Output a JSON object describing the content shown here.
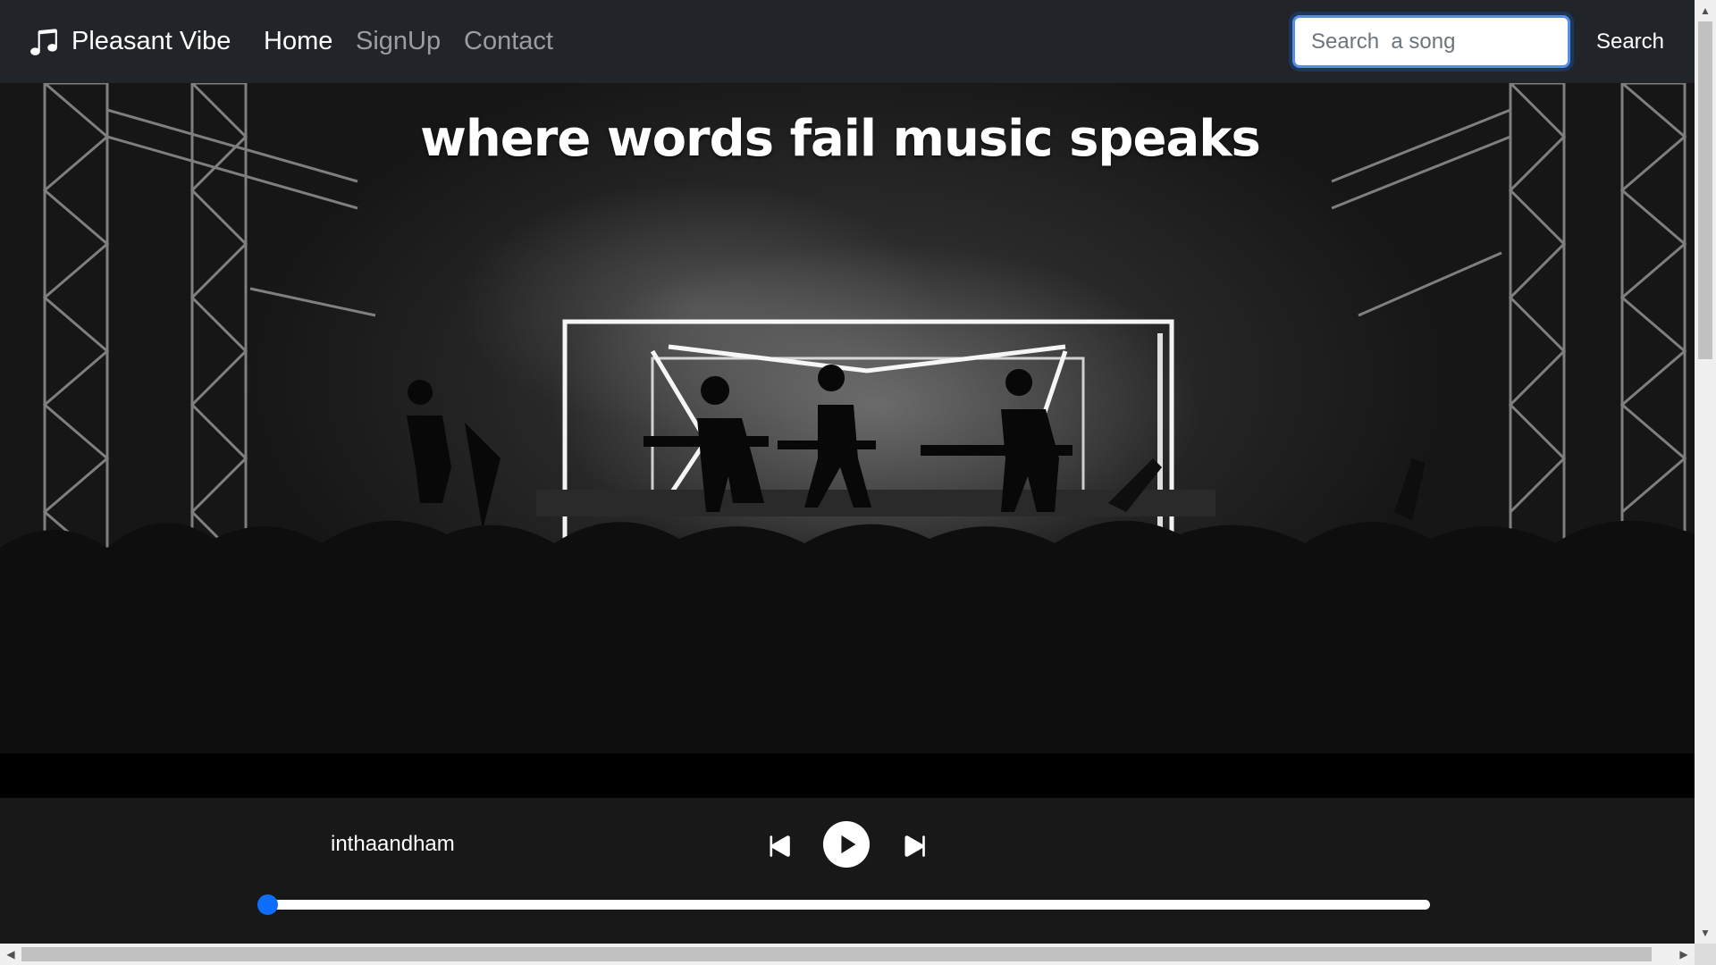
{
  "navbar": {
    "brand_label": "Pleasant Vibe",
    "brand_icon": "music-note-icon",
    "links": [
      {
        "label": "Home",
        "active": true
      },
      {
        "label": "SignUp",
        "active": false
      },
      {
        "label": "Contact",
        "active": false
      }
    ],
    "search": {
      "placeholder": "Search  a song",
      "value": "",
      "button_label": "Search"
    }
  },
  "hero": {
    "heading": "where words fail music speaks",
    "image": "concert-stage-photo"
  },
  "player": {
    "song_title": "inthaandham",
    "controls": [
      "skip-back-icon",
      "play-icon",
      "skip-forward-icon"
    ],
    "progress_percent": 0
  },
  "colors": {
    "navbar_bg": "#212529",
    "player_bg": "#181818",
    "accent": "#0d6efd",
    "text": "#ffffff"
  }
}
